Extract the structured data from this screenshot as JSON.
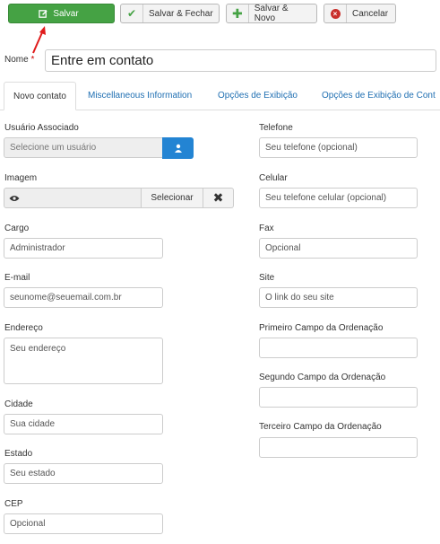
{
  "toolbar": {
    "save": "Salvar",
    "save_close": "Salvar & Fechar",
    "save_new": "Salvar & Novo",
    "cancel": "Cancelar"
  },
  "title": {
    "label": "Nome",
    "required_mark": "*",
    "value": "Entre em contato"
  },
  "tabs": [
    {
      "label": "Novo contato",
      "active": true
    },
    {
      "label": "Miscellaneous Information",
      "active": false
    },
    {
      "label": "Opções de Exibição",
      "active": false
    },
    {
      "label": "Opções de Exibição de Cont",
      "active": false
    }
  ],
  "left": {
    "user": {
      "label": "Usuário Associado",
      "placeholder": "Selecione um usuário"
    },
    "image": {
      "label": "Imagem",
      "select": "Selecionar"
    },
    "cargo": {
      "label": "Cargo",
      "value": "Administrador"
    },
    "email": {
      "label": "E-mail",
      "value": "seunome@seuemail.com.br"
    },
    "endereco": {
      "label": "Endereço",
      "value": "Seu endereço"
    },
    "cidade": {
      "label": "Cidade",
      "value": "Sua cidade"
    },
    "estado": {
      "label": "Estado",
      "value": "Seu estado"
    },
    "cep": {
      "label": "CEP",
      "value": "Opcional"
    }
  },
  "right": {
    "telefone": {
      "label": "Telefone",
      "value": "Seu telefone (opcional)"
    },
    "celular": {
      "label": "Celular",
      "value": "Seu telefone celular (opcional)"
    },
    "fax": {
      "label": "Fax",
      "value": "Opcional"
    },
    "site": {
      "label": "Site",
      "value": "O link do seu site"
    },
    "ord1": {
      "label": "Primeiro Campo da Ordenação",
      "value": ""
    },
    "ord2": {
      "label": "Segundo Campo da Ordenação",
      "value": ""
    },
    "ord3": {
      "label": "Terceiro Campo da Ordenação",
      "value": ""
    }
  },
  "colors": {
    "save_green": "#45a244",
    "link_blue": "#1f6fb2",
    "user_btn_blue": "#2384d3",
    "annotation_red": "#e01b1b"
  }
}
